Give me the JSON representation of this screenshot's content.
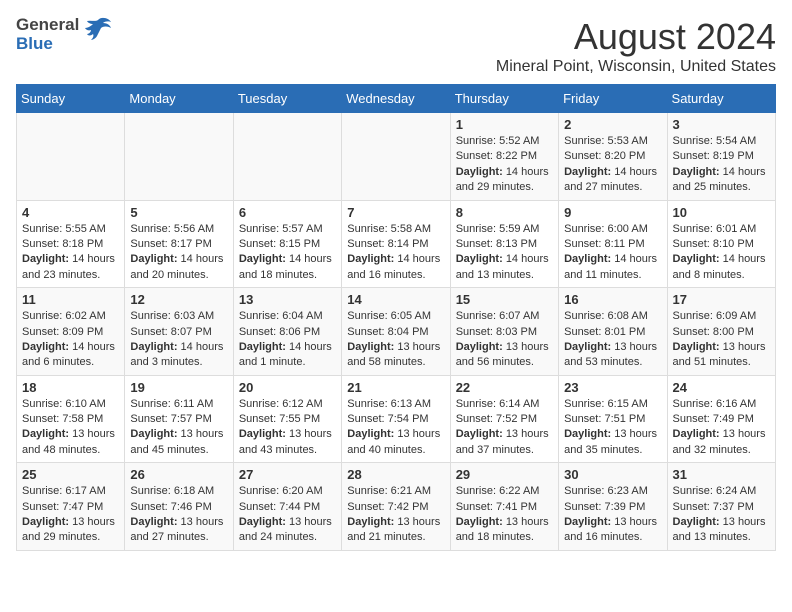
{
  "header": {
    "logo_general": "General",
    "logo_blue": "Blue",
    "title": "August 2024",
    "subtitle": "Mineral Point, Wisconsin, United States"
  },
  "days_of_week": [
    "Sunday",
    "Monday",
    "Tuesday",
    "Wednesday",
    "Thursday",
    "Friday",
    "Saturday"
  ],
  "weeks": [
    [
      {
        "date": "",
        "content": ""
      },
      {
        "date": "",
        "content": ""
      },
      {
        "date": "",
        "content": ""
      },
      {
        "date": "",
        "content": ""
      },
      {
        "date": "1",
        "content": "Sunrise: 5:52 AM\nSunset: 8:22 PM\nDaylight: 14 hours and 29 minutes."
      },
      {
        "date": "2",
        "content": "Sunrise: 5:53 AM\nSunset: 8:20 PM\nDaylight: 14 hours and 27 minutes."
      },
      {
        "date": "3",
        "content": "Sunrise: 5:54 AM\nSunset: 8:19 PM\nDaylight: 14 hours and 25 minutes."
      }
    ],
    [
      {
        "date": "4",
        "content": "Sunrise: 5:55 AM\nSunset: 8:18 PM\nDaylight: 14 hours and 23 minutes."
      },
      {
        "date": "5",
        "content": "Sunrise: 5:56 AM\nSunset: 8:17 PM\nDaylight: 14 hours and 20 minutes."
      },
      {
        "date": "6",
        "content": "Sunrise: 5:57 AM\nSunset: 8:15 PM\nDaylight: 14 hours and 18 minutes."
      },
      {
        "date": "7",
        "content": "Sunrise: 5:58 AM\nSunset: 8:14 PM\nDaylight: 14 hours and 16 minutes."
      },
      {
        "date": "8",
        "content": "Sunrise: 5:59 AM\nSunset: 8:13 PM\nDaylight: 14 hours and 13 minutes."
      },
      {
        "date": "9",
        "content": "Sunrise: 6:00 AM\nSunset: 8:11 PM\nDaylight: 14 hours and 11 minutes."
      },
      {
        "date": "10",
        "content": "Sunrise: 6:01 AM\nSunset: 8:10 PM\nDaylight: 14 hours and 8 minutes."
      }
    ],
    [
      {
        "date": "11",
        "content": "Sunrise: 6:02 AM\nSunset: 8:09 PM\nDaylight: 14 hours and 6 minutes."
      },
      {
        "date": "12",
        "content": "Sunrise: 6:03 AM\nSunset: 8:07 PM\nDaylight: 14 hours and 3 minutes."
      },
      {
        "date": "13",
        "content": "Sunrise: 6:04 AM\nSunset: 8:06 PM\nDaylight: 14 hours and 1 minute."
      },
      {
        "date": "14",
        "content": "Sunrise: 6:05 AM\nSunset: 8:04 PM\nDaylight: 13 hours and 58 minutes."
      },
      {
        "date": "15",
        "content": "Sunrise: 6:07 AM\nSunset: 8:03 PM\nDaylight: 13 hours and 56 minutes."
      },
      {
        "date": "16",
        "content": "Sunrise: 6:08 AM\nSunset: 8:01 PM\nDaylight: 13 hours and 53 minutes."
      },
      {
        "date": "17",
        "content": "Sunrise: 6:09 AM\nSunset: 8:00 PM\nDaylight: 13 hours and 51 minutes."
      }
    ],
    [
      {
        "date": "18",
        "content": "Sunrise: 6:10 AM\nSunset: 7:58 PM\nDaylight: 13 hours and 48 minutes."
      },
      {
        "date": "19",
        "content": "Sunrise: 6:11 AM\nSunset: 7:57 PM\nDaylight: 13 hours and 45 minutes."
      },
      {
        "date": "20",
        "content": "Sunrise: 6:12 AM\nSunset: 7:55 PM\nDaylight: 13 hours and 43 minutes."
      },
      {
        "date": "21",
        "content": "Sunrise: 6:13 AM\nSunset: 7:54 PM\nDaylight: 13 hours and 40 minutes."
      },
      {
        "date": "22",
        "content": "Sunrise: 6:14 AM\nSunset: 7:52 PM\nDaylight: 13 hours and 37 minutes."
      },
      {
        "date": "23",
        "content": "Sunrise: 6:15 AM\nSunset: 7:51 PM\nDaylight: 13 hours and 35 minutes."
      },
      {
        "date": "24",
        "content": "Sunrise: 6:16 AM\nSunset: 7:49 PM\nDaylight: 13 hours and 32 minutes."
      }
    ],
    [
      {
        "date": "25",
        "content": "Sunrise: 6:17 AM\nSunset: 7:47 PM\nDaylight: 13 hours and 29 minutes."
      },
      {
        "date": "26",
        "content": "Sunrise: 6:18 AM\nSunset: 7:46 PM\nDaylight: 13 hours and 27 minutes."
      },
      {
        "date": "27",
        "content": "Sunrise: 6:20 AM\nSunset: 7:44 PM\nDaylight: 13 hours and 24 minutes."
      },
      {
        "date": "28",
        "content": "Sunrise: 6:21 AM\nSunset: 7:42 PM\nDaylight: 13 hours and 21 minutes."
      },
      {
        "date": "29",
        "content": "Sunrise: 6:22 AM\nSunset: 7:41 PM\nDaylight: 13 hours and 18 minutes."
      },
      {
        "date": "30",
        "content": "Sunrise: 6:23 AM\nSunset: 7:39 PM\nDaylight: 13 hours and 16 minutes."
      },
      {
        "date": "31",
        "content": "Sunrise: 6:24 AM\nSunset: 7:37 PM\nDaylight: 13 hours and 13 minutes."
      }
    ]
  ]
}
